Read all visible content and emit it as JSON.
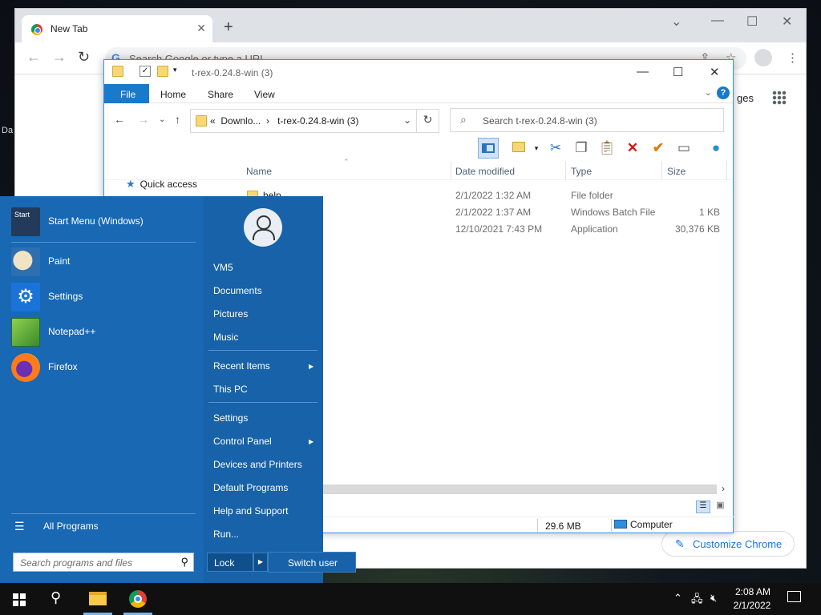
{
  "chrome": {
    "tab_title": "New Tab",
    "omnibox_placeholder": "Search Google or type a URL",
    "images_link": "ges",
    "customize_label": "Customize Chrome"
  },
  "desktop": {
    "partial_label": "Da"
  },
  "explorer": {
    "window_title": "t-rex-0.24.8-win (3)",
    "ribbon_tabs": [
      "File",
      "Home",
      "Share",
      "View"
    ],
    "address_crumbs": [
      "Downlo...",
      "t-rex-0.24.8-win (3)"
    ],
    "search_placeholder": "Search t-rex-0.24.8-win (3)",
    "columns": [
      "Name",
      "Date modified",
      "Type",
      "Size"
    ],
    "quick_access": "Quick access",
    "files": [
      {
        "name": "help",
        "date": "2/1/2022 1:32 AM",
        "type": "File folder",
        "size": ""
      },
      {
        "name": "",
        "date": "2/1/2022 1:37 AM",
        "type": "Windows Batch File",
        "size": "1 KB"
      },
      {
        "name": "",
        "date": "12/10/2021 7:43 PM",
        "type": "Application",
        "size": "30,376 KB"
      }
    ],
    "status_size": "29.6 MB",
    "status_location": "Computer"
  },
  "start_menu": {
    "pinned": [
      {
        "label": "Start Menu (Windows)",
        "icon": "start-menu-icon",
        "icon_text": "Start"
      },
      {
        "label": "Paint",
        "icon": "paint-icon"
      },
      {
        "label": "Settings",
        "icon": "settings-gear-icon"
      },
      {
        "label": "Notepad++",
        "icon": "notepad-plus-plus-icon"
      },
      {
        "label": "Firefox",
        "icon": "firefox-icon"
      }
    ],
    "all_programs": "All Programs",
    "search_placeholder": "Search programs and files",
    "user_name": "VM5",
    "right_items": [
      {
        "label": "VM5"
      },
      {
        "label": "Documents"
      },
      {
        "label": "Pictures"
      },
      {
        "label": "Music"
      },
      {
        "label": "Recent Items",
        "submenu": true
      },
      {
        "label": "This PC"
      },
      {
        "label": "Settings"
      },
      {
        "label": "Control Panel",
        "submenu": true
      },
      {
        "label": "Devices and Printers"
      },
      {
        "label": "Default Programs"
      },
      {
        "label": "Help and Support"
      },
      {
        "label": "Run..."
      }
    ],
    "lock_label": "Lock",
    "switch_user_label": "Switch user",
    "colors": {
      "panel": "#1868b4",
      "right_panel": "#1762a8"
    }
  },
  "taskbar": {
    "time": "2:08 AM",
    "date": "2/1/2022"
  }
}
